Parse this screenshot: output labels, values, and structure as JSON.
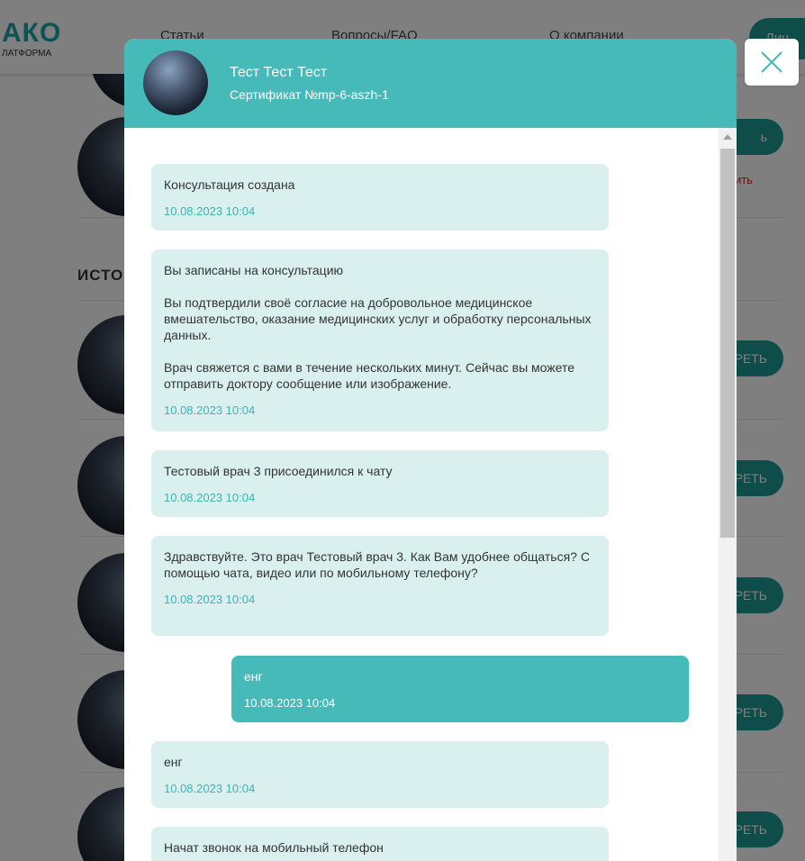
{
  "header": {
    "logo_main": "АКО",
    "logo_sub": "ЛАТФОРМА",
    "nav": [
      "Статьи",
      "Вопросы/FAQ",
      "О компании"
    ],
    "cta_label": "Лич"
  },
  "background": {
    "history_title": "ИСТОР",
    "cancel_label": "ить",
    "row_button_label_top": "ь",
    "row_button_label": "РЕТЬ"
  },
  "modal": {
    "name": "Тест Тест Тест",
    "certificate": "Сертификат №mp-6-aszh-1",
    "close_icon": "close-icon"
  },
  "messages": [
    {
      "direction": "in",
      "text": "Консультация создана",
      "time": "10.08.2023 10:04"
    },
    {
      "direction": "in",
      "text": "Вы записаны на консультацию\n\nВы подтвердили своё согласие на добровольное медицинское вмешательство, оказание медицинских услуг и обработку персональных данных.\n\nВрач свяжется с вами в течение нескольких минут. Сейчас вы можете отправить доктору сообщение или изображение.",
      "time": "10.08.2023 10:04"
    },
    {
      "direction": "in",
      "text": "Тестовый врач 3 присоединился к чату",
      "time": "10.08.2023 10:04"
    },
    {
      "direction": "in",
      "text": "Здравствуйте. Это врач Тестовый врач 3. Как Вам удобнее общаться? С помощью чата, видео или по мобильному телефону?",
      "time": "10.08.2023 10:04"
    },
    {
      "direction": "out",
      "text": "енг",
      "time": "10.08.2023 10:04"
    },
    {
      "direction": "in",
      "text": "енг",
      "time": "10.08.2023 10:04"
    },
    {
      "direction": "in",
      "text": "Начат звонок на мобильный телефон",
      "time": ""
    }
  ],
  "colors": {
    "accent": "#45bab9",
    "incoming_bubble": "#d9f0ef",
    "time_text": "#3eb3b0"
  }
}
